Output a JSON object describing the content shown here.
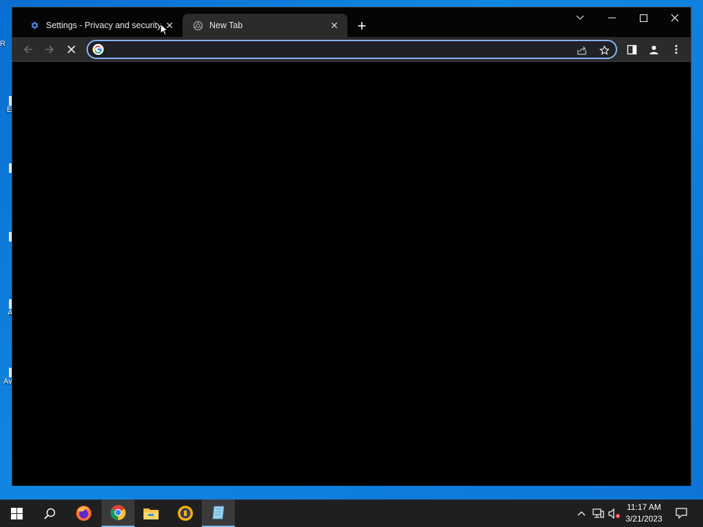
{
  "desktop": {
    "icon_labels": [
      "R",
      "E",
      "A",
      "Av"
    ]
  },
  "browser": {
    "tabs": [
      {
        "label": "Settings - Privacy and security",
        "favicon": "gear-icon",
        "active": false
      },
      {
        "label": "New Tab",
        "favicon": "chrome-loading-icon",
        "active": true
      }
    ],
    "new_tab_symbol": "+",
    "omnibox": {
      "value": "",
      "placeholder": ""
    },
    "accent": "#8ab4f8"
  },
  "taskbar": {
    "apps": [
      "start-icon",
      "search-icon",
      "firefox-icon",
      "chrome-icon",
      "file-explorer-icon",
      "app-icon",
      "notepad-icon"
    ],
    "clock": {
      "time": "11:17 AM",
      "date": "3/21/2023"
    }
  },
  "colors": {
    "desktop": "#0d74d6",
    "titlebar": "#050505",
    "toolbar": "#2b2b2b",
    "taskbar": "#1f1f1f"
  }
}
